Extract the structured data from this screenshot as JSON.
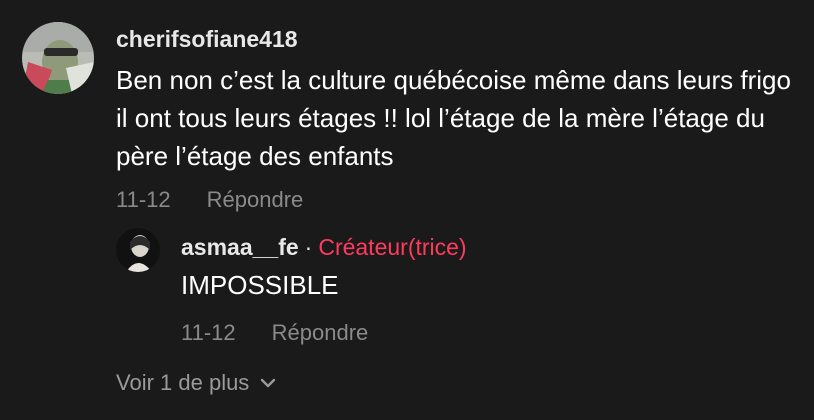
{
  "comment": {
    "username": "cherifsofiane418",
    "text": "Ben non c’est la culture québécoise même dans leurs frigo il ont tous leurs étages !! lol l’étage de la mère l’étage du père l’étage des enfants",
    "date": "11-12",
    "reply_label": "Répondre"
  },
  "reply": {
    "username": "asmaa__fe",
    "separator": "·",
    "creator_label": "Créateur(trice)",
    "text": "IMPOSSIBLE",
    "date": "11-12",
    "reply_label": "Répondre"
  },
  "view_more": {
    "label": "Voir 1 de plus",
    "icon": "chevron-down-icon"
  },
  "colors": {
    "background": "#1a1a1a",
    "text": "#ffffff",
    "meta": "#8a8a8a",
    "creator_accent": "#fe3b5c"
  }
}
